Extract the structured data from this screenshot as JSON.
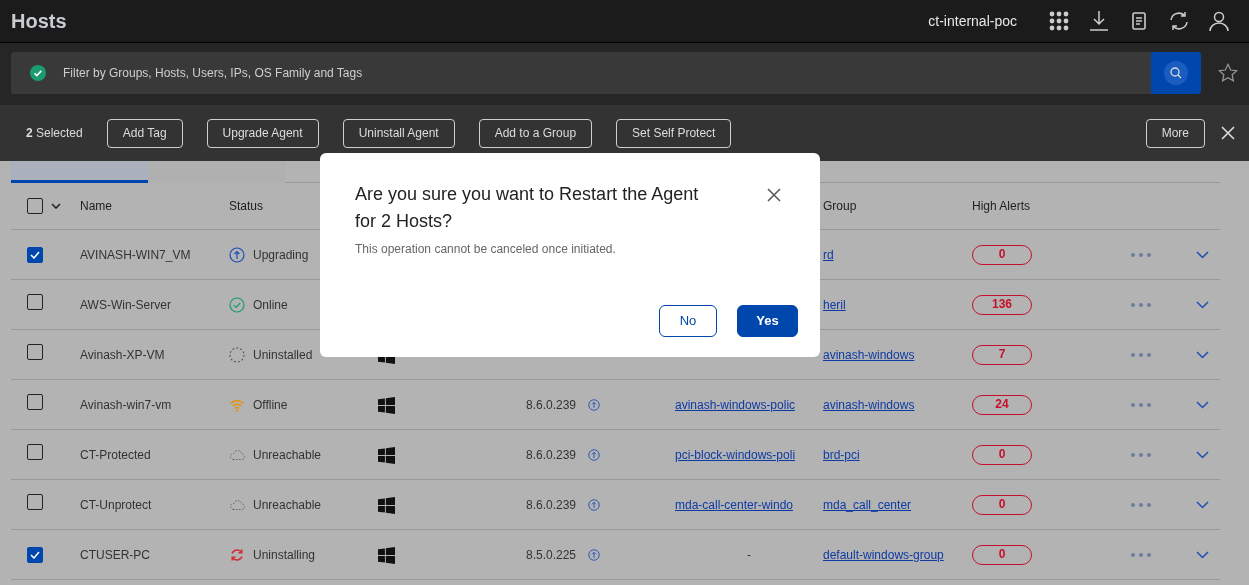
{
  "header": {
    "title": "Hosts",
    "tenant": "ct-internal-poc"
  },
  "search": {
    "placeholder": "Filter by Groups, Hosts, Users, IPs, OS Family and Tags"
  },
  "action_bar": {
    "selected_count": "**2** Selected",
    "buttons": [
      "Add Tag",
      "Upgrade Agent",
      "Uninstall Agent",
      "Add to a Group",
      "Set Self Protect"
    ],
    "more": "More"
  },
  "tabs": [
    {
      "selected": true
    },
    {
      "selected": false
    }
  ],
  "table": {
    "all_checked": false,
    "columns": [
      "Name",
      "Status",
      "Group",
      "High Alerts"
    ],
    "rows": [
      {
        "checked": true,
        "name": "AVINASH-WIN7_VM",
        "status": "Upgrading",
        "kind": "upgrading",
        "os_visible": false,
        "group": "rd",
        "alerts": "0"
      },
      {
        "checked": false,
        "name": "AWS-Win-Server",
        "status": "Online",
        "kind": "online",
        "os_visible": false,
        "group": "heril",
        "alerts": "136"
      },
      {
        "checked": false,
        "name": "Avinash-XP-VM",
        "status": "Uninstalled",
        "kind": "uninstalled",
        "os_visible": true,
        "group": "avinash-windows",
        "alerts": "7"
      },
      {
        "checked": false,
        "name": "Avinash-win7-vm",
        "status": "Offline",
        "kind": "offline",
        "os_visible": true,
        "version": "8.6.0.239",
        "policy": "avinash-windows-polic",
        "group": "avinash-windows",
        "alerts": "24"
      },
      {
        "checked": false,
        "name": "CT-Protected",
        "status": "Unreachable",
        "kind": "unreachable",
        "os_visible": true,
        "version": "8.6.0.239",
        "policy": "pci-block-windows-poli",
        "group": "brd-pci",
        "alerts": "0"
      },
      {
        "checked": false,
        "name": "CT-Unprotect",
        "status": "Unreachable",
        "kind": "unreachable",
        "os_visible": true,
        "version": "8.6.0.239",
        "policy": "mda-call-center-windo",
        "group": "mda_call_center",
        "alerts": "0"
      },
      {
        "checked": true,
        "name": "CTUSER-PC",
        "status": "Uninstalling",
        "kind": "uninstalling",
        "os_visible": true,
        "version": "8.5.0.225",
        "policy": "-",
        "group": "default-windows-group",
        "alerts": "0"
      }
    ]
  },
  "dialog": {
    "title": "Are you sure you want to Restart the Agent for 2 Hosts?",
    "message": "This operation cannot be canceled once initiated.",
    "buttons": [
      {
        "label": "No",
        "kind": "secondary"
      },
      {
        "label": "Yes",
        "kind": "primary"
      }
    ]
  }
}
